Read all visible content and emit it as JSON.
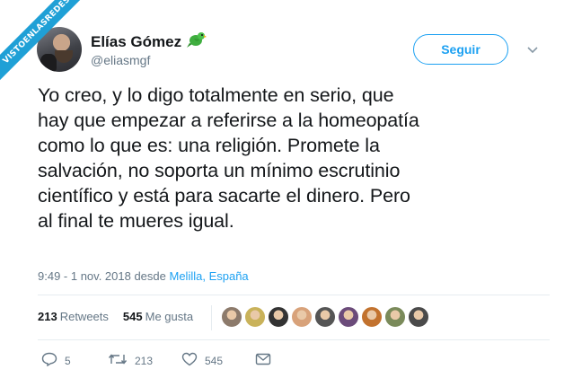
{
  "watermark": "VISTOENLASREDES",
  "author": {
    "name": "Elías Gómez",
    "handle": "@eliasmgf",
    "emoji": "🦜"
  },
  "follow_label": "Seguir",
  "tweet": {
    "text": "Yo creo, y lo digo totalmente en serio, que\nhay que empezar a referirse a la homeopatía\ncomo lo que es: una religión. Promete la\nsalvación, no soporta un mínimo escrutinio\ncientífico y está para sacarte el dinero. Pero\nal final te mueres igual.",
    "timestamp": "9:49 - 1 nov. 2018 desde",
    "location": "Melilla, España"
  },
  "stats": {
    "retweets_count": "213",
    "retweets_label": "Retweets",
    "likes_count": "545",
    "likes_label": "Me gusta"
  },
  "likers_colors": [
    "#8c7a6b",
    "#c9b25a",
    "#333333",
    "#d8a27a",
    "#555555",
    "#6b4b7a",
    "#c2722e",
    "#7a8a5a",
    "#4a4a4a"
  ],
  "actions": {
    "reply_count": "5",
    "retweet_count": "213",
    "like_count": "545"
  },
  "colors": {
    "accent": "#1da1f2",
    "secondary_text": "#657786",
    "watermark_bg": "#1fa0d6"
  }
}
